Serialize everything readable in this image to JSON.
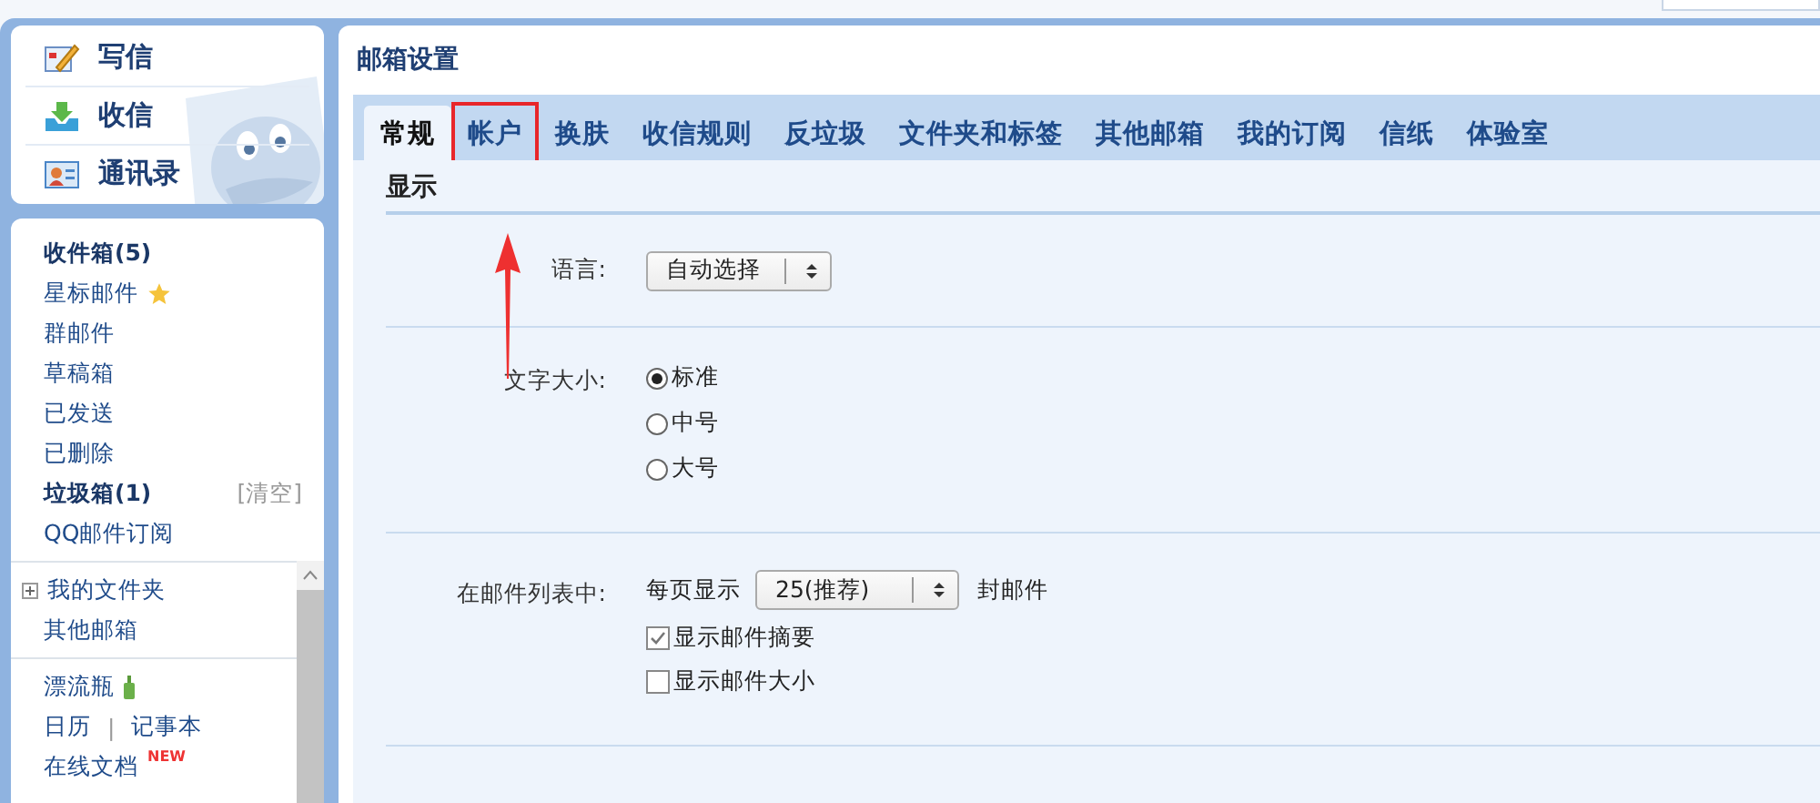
{
  "quick_actions": [
    {
      "kind": "compose",
      "label": "写信"
    },
    {
      "kind": "receive",
      "label": "收信"
    },
    {
      "kind": "contacts",
      "label": "通讯录"
    }
  ],
  "folder_groups": [
    {
      "items": [
        {
          "kind": "plain",
          "label": "收件箱(5)",
          "bold": true
        },
        {
          "kind": "star",
          "label": "星标邮件",
          "bold": false
        },
        {
          "kind": "plain",
          "label": "群邮件",
          "bold": false
        },
        {
          "kind": "plain",
          "label": "草稿箱",
          "bold": false
        },
        {
          "kind": "plain",
          "label": "已发送",
          "bold": false
        },
        {
          "kind": "plain",
          "label": "已删除",
          "bold": false
        },
        {
          "kind": "action",
          "label": "垃圾箱(1)",
          "bold": true,
          "action": "[清空]"
        },
        {
          "kind": "plain",
          "label": "QQ邮件订阅",
          "bold": false
        }
      ]
    },
    {
      "items": [
        {
          "kind": "expander",
          "label": "我的文件夹",
          "bold": false
        },
        {
          "kind": "plain",
          "label": "其他邮箱",
          "bold": false
        }
      ]
    },
    {
      "items": [
        {
          "kind": "bottle",
          "label": "漂流瓶",
          "bold": false
        },
        {
          "kind": "pair",
          "label": "日历",
          "second": "记事本",
          "separator": "|",
          "bold": false
        },
        {
          "kind": "new",
          "label": "在线文档",
          "badge": "NEW",
          "bold": false
        }
      ]
    }
  ],
  "page_title": "邮箱设置",
  "tabs": [
    {
      "label": "常规",
      "selected": true,
      "highlighted": false
    },
    {
      "label": "帐户",
      "selected": false,
      "highlighted": true
    },
    {
      "label": "换肤",
      "selected": false,
      "highlighted": false
    },
    {
      "label": "收信规则",
      "selected": false,
      "highlighted": false
    },
    {
      "label": "反垃圾",
      "selected": false,
      "highlighted": false
    },
    {
      "label": "文件夹和标签",
      "selected": false,
      "highlighted": false
    },
    {
      "label": "其他邮箱",
      "selected": false,
      "highlighted": false
    },
    {
      "label": "我的订阅",
      "selected": false,
      "highlighted": false
    },
    {
      "label": "信纸",
      "selected": false,
      "highlighted": false
    },
    {
      "label": "体验室",
      "selected": false,
      "highlighted": false
    }
  ],
  "section_title": "显示",
  "settings": [
    {
      "kind": "select",
      "label": "语言:",
      "value": "自动选择"
    },
    {
      "kind": "radio",
      "label": "文字大小:",
      "options": [
        {
          "label": "标准",
          "selected": true
        },
        {
          "label": "中号",
          "selected": false
        },
        {
          "label": "大号",
          "selected": false
        }
      ]
    },
    {
      "kind": "list",
      "label": "在邮件列表中:",
      "prefix": "每页显示",
      "value": "25(推荐)",
      "suffix": "封邮件",
      "checks": [
        {
          "label": "显示邮件摘要",
          "checked": true
        },
        {
          "label": "显示邮件大小",
          "checked": false
        }
      ]
    }
  ]
}
